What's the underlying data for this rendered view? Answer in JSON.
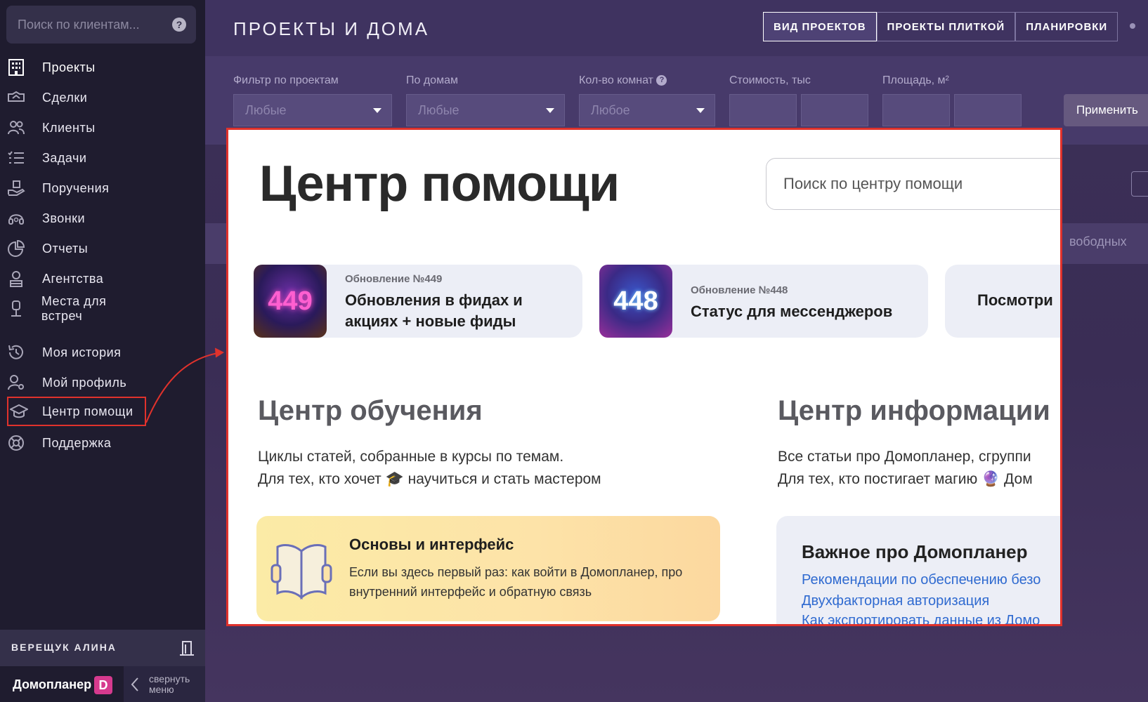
{
  "sidebar": {
    "search_placeholder": "Поиск по клиентам...",
    "help_glyph": "?",
    "items": [
      {
        "label": "Проекты",
        "icon": "building-grid-icon"
      },
      {
        "label": "Сделки",
        "icon": "handshake-icon"
      },
      {
        "label": "Клиенты",
        "icon": "users-icon"
      },
      {
        "label": "Задачи",
        "icon": "checklist-icon"
      },
      {
        "label": "Поручения",
        "icon": "hand-task-icon"
      },
      {
        "label": "Звонки",
        "icon": "headset-icon"
      },
      {
        "label": "Отчеты",
        "icon": "pie-chart-icon"
      },
      {
        "label": "Агентства",
        "icon": "agent-icon"
      },
      {
        "label": "Места для встреч",
        "icon": "meeting-place-icon"
      },
      {
        "label": "Моя история",
        "icon": "history-icon"
      },
      {
        "label": "Мой профиль",
        "icon": "profile-settings-icon"
      },
      {
        "label": "Центр помощи",
        "icon": "graduation-cap-icon"
      },
      {
        "label": "Поддержка",
        "icon": "lifebuoy-icon"
      }
    ],
    "user_name": "ВЕРЕЩУК АЛИНА",
    "brand_name": "Домопланер",
    "brand_logo": "D",
    "collapse_label": "свернуть меню"
  },
  "header": {
    "title": "ПРОЕКТЫ И ДОМА",
    "tabs": [
      {
        "label": "ВИД ПРОЕКТОВ",
        "active": true
      },
      {
        "label": "ПРОЕКТЫ ПЛИТКОЙ",
        "active": false
      },
      {
        "label": "ПЛАНИРОВКИ",
        "active": false
      }
    ]
  },
  "filters": {
    "projects_label": "Фильтр по проектам",
    "projects_value": "Любые",
    "houses_label": "По домам",
    "houses_value": "Любые",
    "rooms_label": "Кол-во комнат",
    "rooms_value": "Любое",
    "cost_label": "Стоимость, тыс",
    "area_label": "Площадь, м²",
    "apply_label": "Применить"
  },
  "background": {
    "free_text": "вободных"
  },
  "help_center": {
    "title": "Центр помощи",
    "search_placeholder": "Поиск по центру помощи",
    "updates": [
      {
        "number": "449",
        "kicker": "Обновление №449",
        "title": "Обновления в фидах и акциях + новые фиды"
      },
      {
        "number": "448",
        "kicker": "Обновление №448",
        "title": "Статус для мессенджеров"
      },
      {
        "title": "Посмотри"
      }
    ],
    "learning": {
      "title": "Центр обучения",
      "desc_line1": "Циклы статей, собранные в курсы по темам.",
      "desc_line2": "Для тех, кто хочет 🎓 научиться и стать мастером"
    },
    "info": {
      "title": "Центр информации",
      "desc_line1": "Все статьи про Домопланер, сгруппи",
      "desc_line2": "Для тех, кто постигает магию 🔮 Дом"
    },
    "course_card": {
      "title": "Основы и интерфейс",
      "desc": "Если вы здесь первый раз: как войти в Домопланер, про внутренний интерфейс и обратную связь"
    },
    "info_card": {
      "title": "Важное про Домопланер",
      "links": [
        "Рекомендации по обеспечению безо",
        "Двухфакторная авторизация",
        "Как экспортировать данные из Домо"
      ]
    }
  },
  "colors": {
    "sidebar_bg": "#1f1c2f",
    "accent_red": "#e0322c",
    "link_blue": "#2f6ad0",
    "brand_pink": "#d63a8e"
  }
}
